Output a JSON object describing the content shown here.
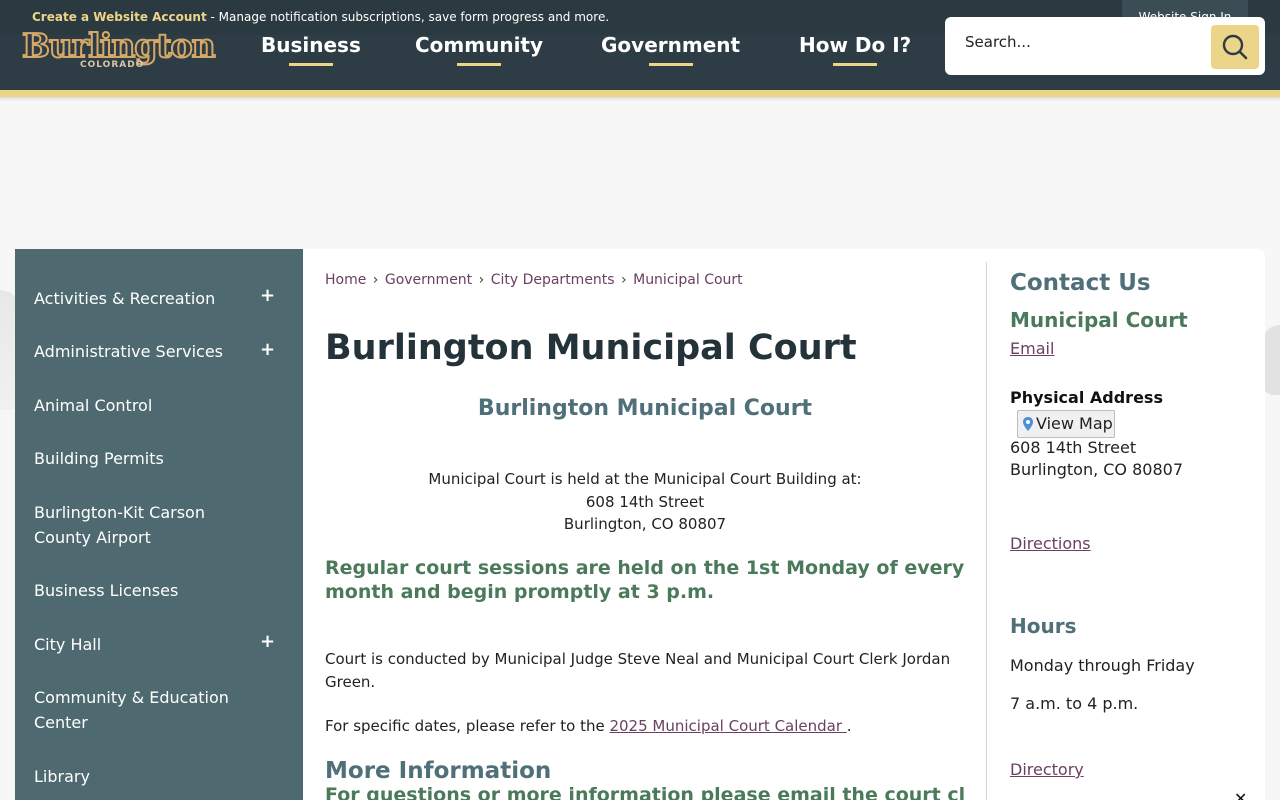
{
  "topbar": {
    "account_link": "Create a Website Account",
    "account_desc": " - Manage notification subscriptions, save form progress and more.",
    "signin": "Website Sign In"
  },
  "logo": {
    "word": "Burlington",
    "sub": "COLORADO"
  },
  "nav": [
    "Business",
    "Community",
    "Government",
    "How Do I?"
  ],
  "search": {
    "placeholder": "Search..."
  },
  "sidebar": {
    "items": [
      {
        "label": "Activities & Recreation",
        "expandable": "+"
      },
      {
        "label": "Administrative Services",
        "expandable": "+"
      },
      {
        "label": "Animal Control"
      },
      {
        "label": "Building Permits"
      },
      {
        "label": "Burlington-Kit Carson County Airport"
      },
      {
        "label": "Business Licenses"
      },
      {
        "label": "City Hall",
        "expandable": "+"
      },
      {
        "label": "Community & Education Center"
      },
      {
        "label": "Library"
      }
    ]
  },
  "breadcrumb": [
    "Home",
    "Government",
    "City Departments",
    "Municipal Court"
  ],
  "breadcrumb_sep": "›",
  "main": {
    "title": "Burlington Municipal Court",
    "subtitle": "Burlington Municipal Court",
    "address_intro": "Municipal Court is held at the Municipal Court Building at:",
    "address_street": "608 14th Street",
    "address_city": "Burlington, CO 80807",
    "sessions": "Regular court sessions are held on the 1st Monday of every month and begin promptly at 3 p.m.",
    "conducted": "Court is conducted by Municipal Judge Steve Neal and Municipal Court Clerk Jordan Green.",
    "dates_prefix": "For specific dates, please refer to the ",
    "dates_link": "2025 Municipal Court Calendar ",
    "dates_suffix": ".",
    "more_title": "More Information",
    "more_line": "For questions or more information please email the court clerk"
  },
  "contact": {
    "heading": "Contact Us",
    "dept": "Municipal Court",
    "email": "Email",
    "address_label": "Physical Address",
    "map_button": "View Map",
    "street": "608 14th Street",
    "city": "Burlington, CO 80807",
    "directions": "Directions",
    "hours_heading": "Hours",
    "hours_days": "Monday through Friday",
    "hours_time": "7 a.m. to 4 p.m.",
    "directory": "Directory"
  },
  "colors": {
    "header": "#2e3d45",
    "accent": "#ecd489",
    "sidebar": "#4e6a70",
    "link": "#6b4061",
    "heading_green": "#4a7a5a",
    "heading_teal": "#4f6f79"
  },
  "icons": {
    "search": "search-icon",
    "map_pin": "map-pin-icon",
    "close": "close-icon"
  },
  "close_glyph": "✕"
}
